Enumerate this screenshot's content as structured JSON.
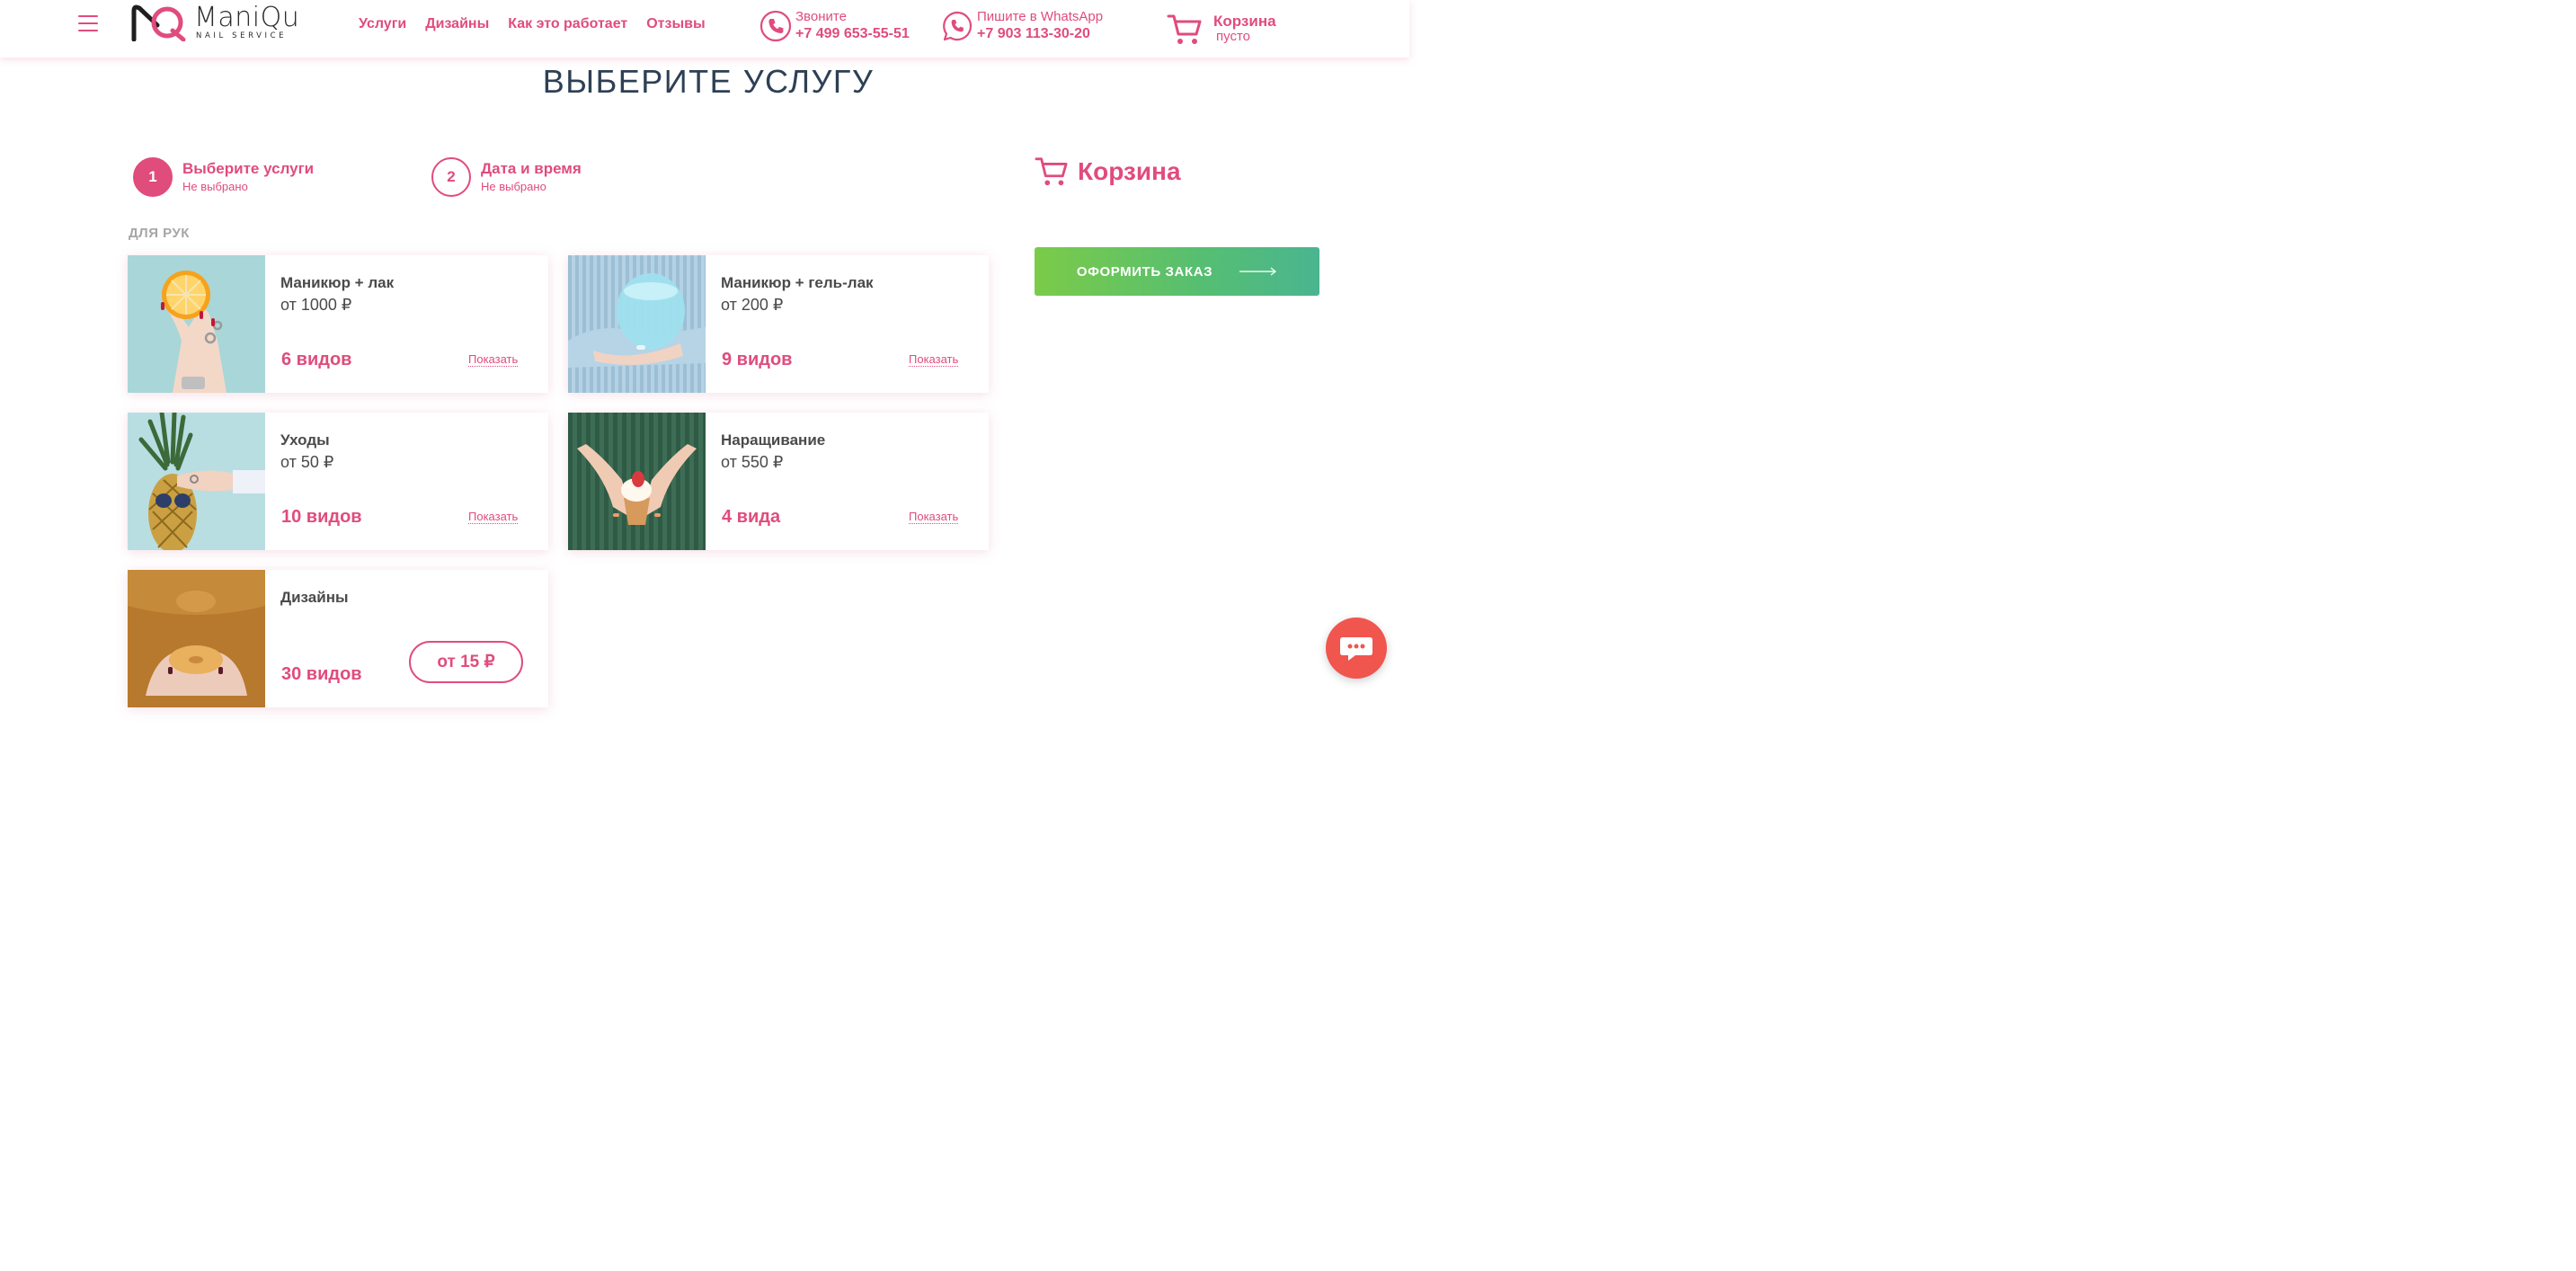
{
  "header": {
    "logo_name": "ManiQu",
    "logo_sub": "NAIL SERVICE",
    "nav": [
      "Услуги",
      "Дизайны",
      "Как это работает",
      "Отзывы"
    ],
    "call": {
      "label": "Звоните",
      "number": "+7 499 653-55-51"
    },
    "whatsapp": {
      "label": "Пишите в WhatsApp",
      "number": "+7 903 113-30-20"
    },
    "cart": {
      "title": "Корзина",
      "status": "пусто"
    }
  },
  "page_title": "ВЫБЕРИТЕ УСЛУГУ",
  "steps": [
    {
      "number": "1",
      "title": "Выберите услуги",
      "subtitle": "Не выбрано"
    },
    {
      "number": "2",
      "title": "Дата и время",
      "subtitle": "Не выбрано"
    }
  ],
  "section_label": "ДЛЯ РУК",
  "cards": [
    {
      "name": "Маникюр + лак",
      "price": "от 1000 ₽",
      "count": "6 видов",
      "action": "Показать"
    },
    {
      "name": "Маникюр + гель-лак",
      "price": "от 200 ₽",
      "count": "9 видов",
      "action": "Показать"
    },
    {
      "name": "Уходы",
      "price": "от 50 ₽",
      "count": "10 видов",
      "action": "Показать"
    },
    {
      "name": "Наращивание",
      "price": "от 550 ₽",
      "count": "4 вида",
      "action": "Показать"
    },
    {
      "name": "Дизайны",
      "price": "от 15 ₽",
      "count": "30 видов"
    }
  ],
  "side_cart": {
    "title": "Корзина",
    "order_button": "ОФОРМИТЬ ЗАКАЗ"
  },
  "icons": [
    "menu-icon",
    "phone-icon",
    "whatsapp-icon",
    "cart-icon",
    "arrow-right-icon",
    "chat-icon"
  ],
  "colors": {
    "accent": "#e04c7c",
    "title": "#2e4055",
    "order_button_start": "#7bcb48",
    "order_button_end": "#4ab590",
    "chat": "#f0554e"
  }
}
